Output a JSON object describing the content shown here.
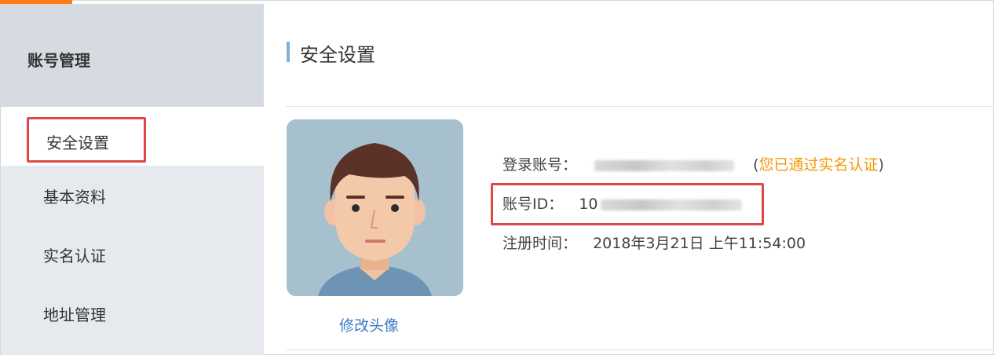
{
  "sidebar": {
    "header": "账号管理",
    "items": [
      {
        "label": "安全设置",
        "active": true
      },
      {
        "label": "基本资料",
        "active": false
      },
      {
        "label": "实名认证",
        "active": false
      },
      {
        "label": "地址管理",
        "active": false
      }
    ]
  },
  "main": {
    "title": "安全设置",
    "avatar": {
      "icon": "user-avatar-icon",
      "change_label": "修改头像"
    },
    "info": {
      "login_label": "登录账号：",
      "verify_open": "(",
      "verify_text": "您已通过实名认证",
      "verify_close": ")",
      "id_label": "账号ID：",
      "id_value_prefix": "10",
      "reg_label": "注册时间：",
      "reg_value": "2018年3月21日 上午11:54:00"
    }
  },
  "colors": {
    "accent_orange": "#ff7a1a",
    "highlight_red": "#e04848",
    "link_blue": "#3a7bc8",
    "verify_orange": "#f39800",
    "title_bar_blue": "#7fb0d8"
  }
}
